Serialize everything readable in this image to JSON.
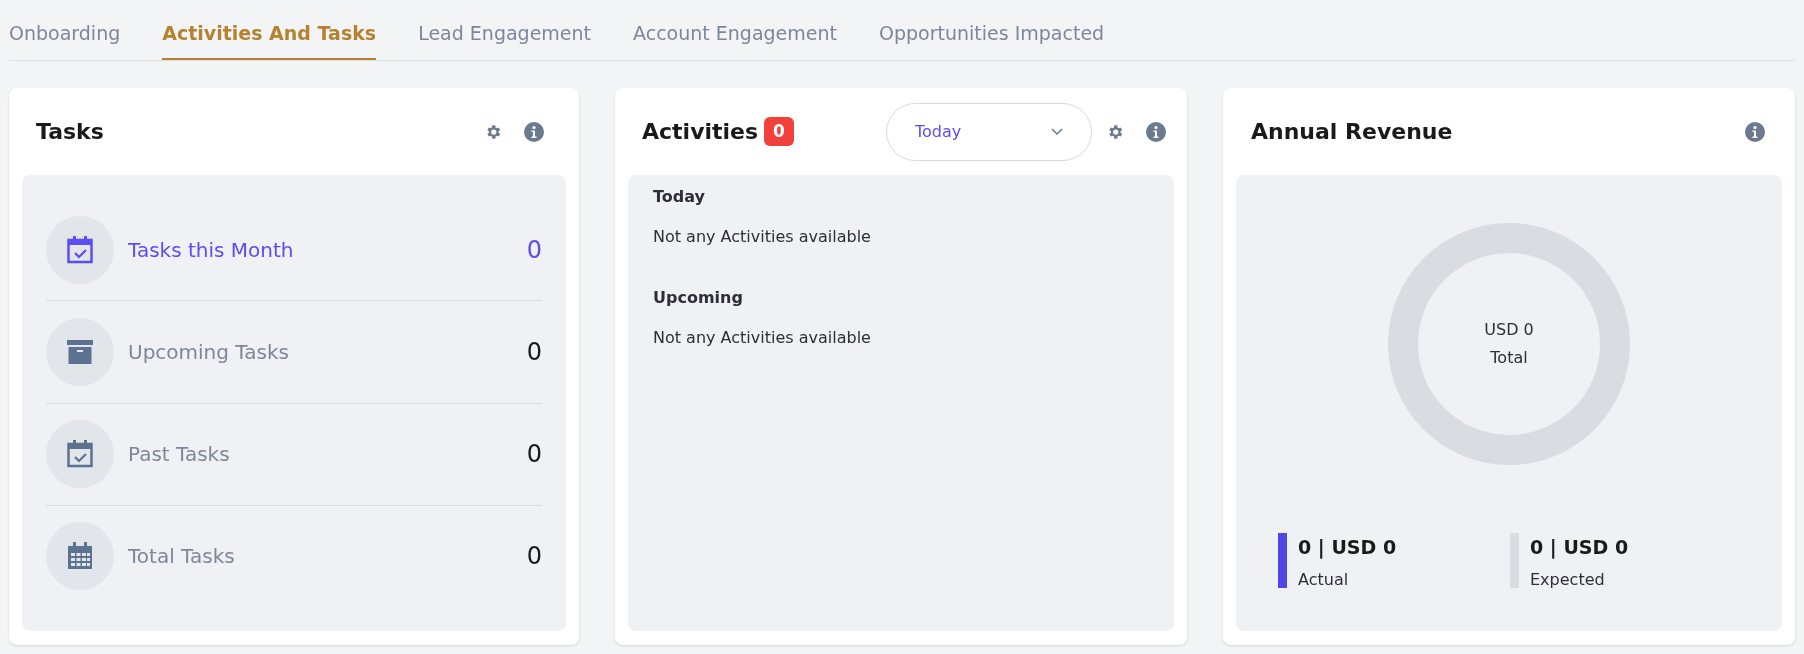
{
  "tabs": [
    {
      "label": "Onboarding",
      "selected": false
    },
    {
      "label": "Activities And Tasks",
      "selected": true
    },
    {
      "label": "Lead Engagement",
      "selected": false
    },
    {
      "label": "Account Engagement",
      "selected": false
    },
    {
      "label": "Opportunities Impacted",
      "selected": false
    }
  ],
  "tasks_card": {
    "title": "Tasks",
    "items": [
      {
        "label": "Tasks this Month",
        "count": "0",
        "selected": true
      },
      {
        "label": "Upcoming Tasks",
        "count": "0",
        "selected": false
      },
      {
        "label": "Past Tasks",
        "count": "0",
        "selected": false
      },
      {
        "label": "Total Tasks",
        "count": "0",
        "selected": false
      }
    ]
  },
  "activities_card": {
    "title": "Activities",
    "badge": "0",
    "period_select": {
      "value": "Today"
    },
    "sections": [
      {
        "heading": "Today",
        "message": "Not any Activities available"
      },
      {
        "heading": "Upcoming",
        "message": "Not any Activities available"
      }
    ]
  },
  "revenue_card": {
    "title": "Annual Revenue",
    "center_value": "USD 0",
    "center_label": "Total",
    "legend": [
      {
        "value": "0 | USD 0",
        "label": "Actual",
        "color": "#4f46e5"
      },
      {
        "value": "0 | USD 0",
        "label": "Expected",
        "color": "#d9dce1"
      }
    ]
  }
}
